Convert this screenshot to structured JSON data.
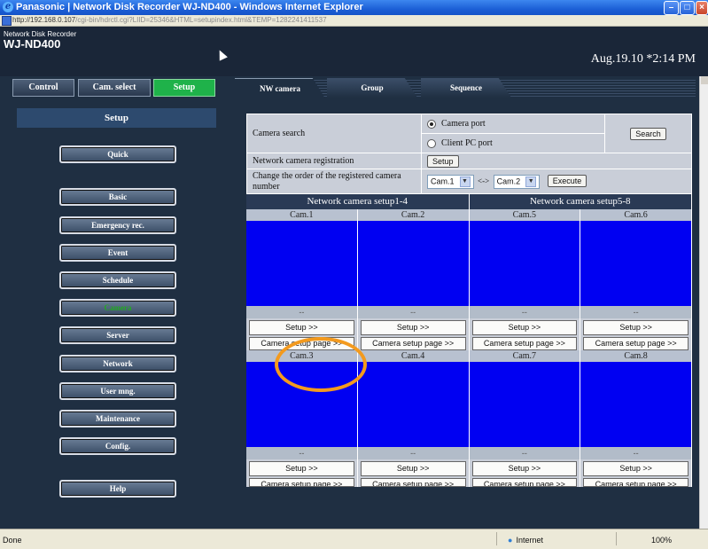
{
  "browser": {
    "title": "Panasonic | Network Disk Recorder WJ-ND400 - Windows Internet Explorer",
    "address_host": "http://192.168.0.107",
    "address_path": "/cgi-bin/hdrctl.cgi?LIID=25346&HTML=setupindex.html&TEMP=1282241411537",
    "status_left": "Done",
    "status_zone": "Internet",
    "status_zoom": "100%"
  },
  "header": {
    "brand_small": "Network Disk Recorder",
    "brand_model": "WJ-ND400",
    "datetime": "Aug.19.10 *2:14 PM"
  },
  "mode_tabs": [
    {
      "label": "Control"
    },
    {
      "label": "Cam. select"
    },
    {
      "label": "Setup"
    }
  ],
  "sidebar": {
    "title": "Setup",
    "items": [
      {
        "label": "Quick"
      },
      {
        "label": "Basic"
      },
      {
        "label": "Emergency rec."
      },
      {
        "label": "Event"
      },
      {
        "label": "Schedule"
      },
      {
        "label": "Camera"
      },
      {
        "label": "Server"
      },
      {
        "label": "Network"
      },
      {
        "label": "User mng."
      },
      {
        "label": "Maintenance"
      },
      {
        "label": "Config."
      },
      {
        "label": "Help"
      }
    ]
  },
  "tabs": [
    {
      "label": "NW camera"
    },
    {
      "label": "Group"
    },
    {
      "label": "Sequence"
    }
  ],
  "form": {
    "camera_search_label": "Camera search",
    "radio_camera_port": "Camera port",
    "radio_client_pc_port": "Client PC port",
    "search_button": "Search",
    "registration_label": "Network camera registration",
    "setup_button": "Setup",
    "order_label": "Change the order of the registered camera number",
    "order_from": "Cam.1",
    "order_arrow": "<->",
    "order_to": "Cam.2",
    "execute_button": "Execute"
  },
  "groups": [
    {
      "label": "Network camera setup1-4"
    },
    {
      "label": "Network camera setup5-8"
    }
  ],
  "cams_row1": [
    {
      "name": "Cam.1",
      "status": "--",
      "setup": "Setup >>",
      "page": "Camera setup page >>"
    },
    {
      "name": "Cam.2",
      "status": "--",
      "setup": "Setup >>",
      "page": "Camera setup page >>"
    },
    {
      "name": "Cam.5",
      "status": "--",
      "setup": "Setup >>",
      "page": "Camera setup page >>"
    },
    {
      "name": "Cam.6",
      "status": "--",
      "setup": "Setup >>",
      "page": "Camera setup page >>"
    }
  ],
  "cams_row2": [
    {
      "name": "Cam.3",
      "status": "--",
      "setup": "Setup >>",
      "page": "Camera setup page >>"
    },
    {
      "name": "Cam.4",
      "status": "--",
      "setup": "Setup >>",
      "page": "Camera setup page >>"
    },
    {
      "name": "Cam.7",
      "status": "--",
      "setup": "Setup >>",
      "page": "Camera setup page >>"
    },
    {
      "name": "Cam.8",
      "status": "--",
      "setup": "Setup >>",
      "page": "Camera setup page >>"
    }
  ],
  "colors": {
    "camera_view": "#0000f2",
    "highlight_ring": "#f39a1e",
    "active_tab": "#1fb24a"
  }
}
